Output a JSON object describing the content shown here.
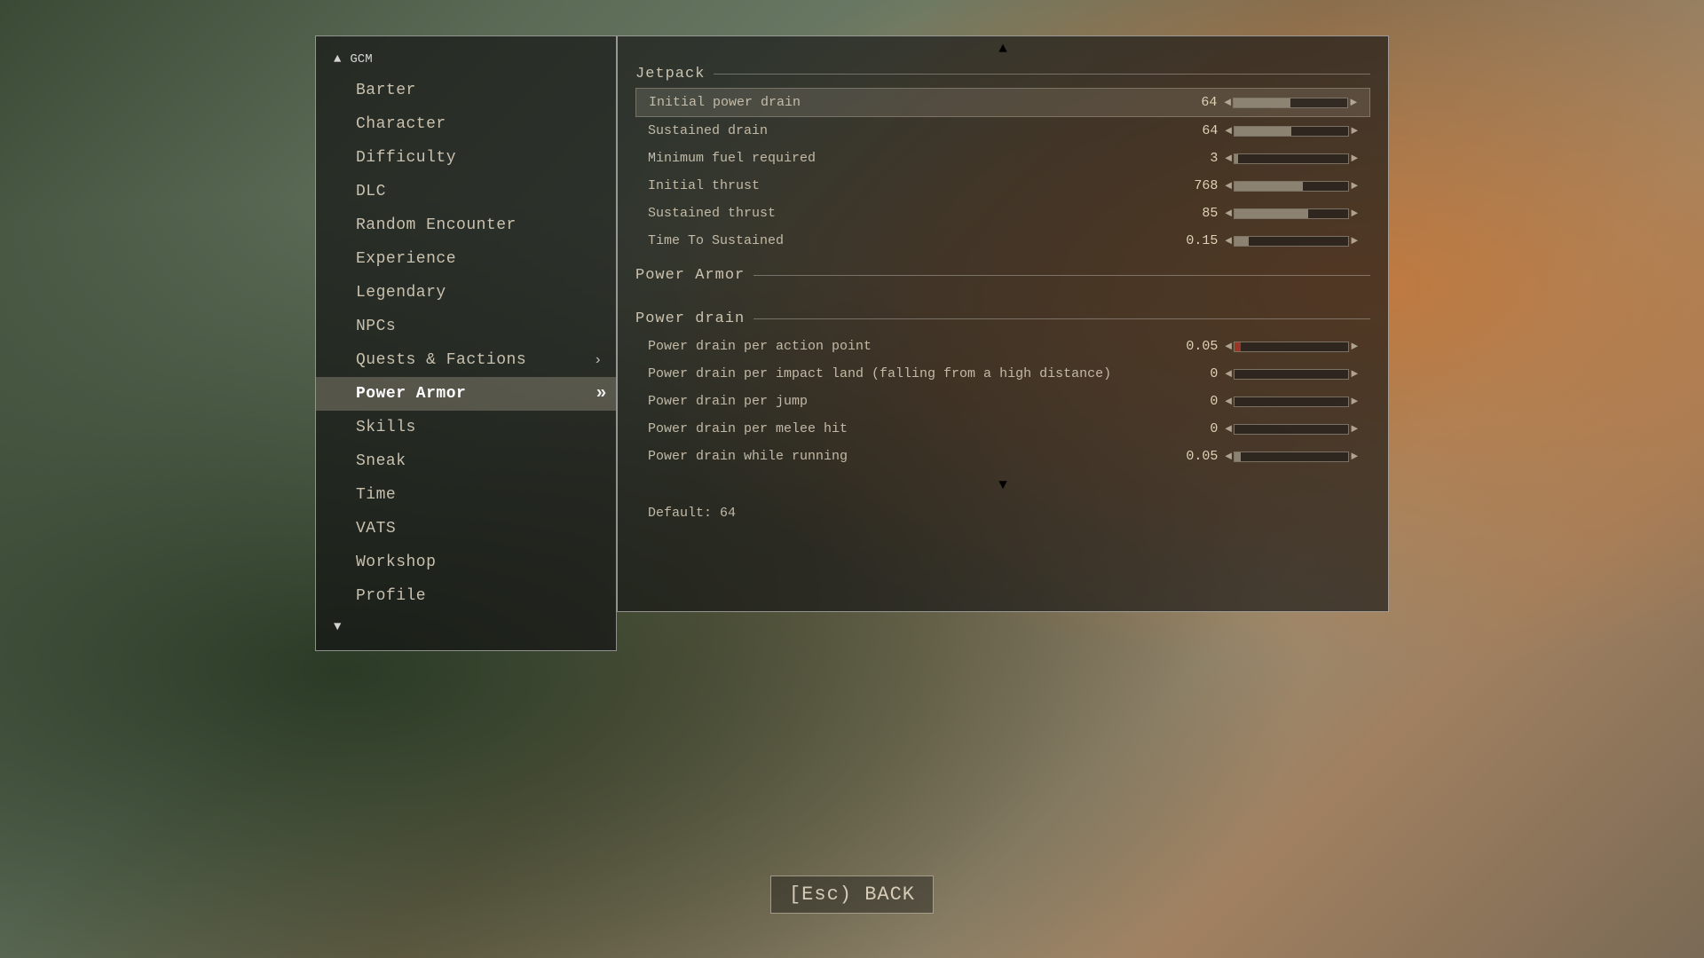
{
  "leftPanel": {
    "gcm_label": "GCM",
    "up_arrow": "▲",
    "down_arrow": "▼",
    "items": [
      {
        "label": "Barter",
        "active": false,
        "has_arrow": false
      },
      {
        "label": "Character",
        "active": false,
        "has_arrow": false
      },
      {
        "label": "Difficulty",
        "active": false,
        "has_arrow": false
      },
      {
        "label": "DLC",
        "active": false,
        "has_arrow": false
      },
      {
        "label": "Random Encounter",
        "active": false,
        "has_arrow": false
      },
      {
        "label": "Experience",
        "active": false,
        "has_arrow": false
      },
      {
        "label": "Legendary",
        "active": false,
        "has_arrow": false
      },
      {
        "label": "NPCs",
        "active": false,
        "has_arrow": false
      },
      {
        "label": "Quests & Factions",
        "active": false,
        "has_arrow": true
      },
      {
        "label": "Power Armor",
        "active": true,
        "has_arrow": true
      },
      {
        "label": "Skills",
        "active": false,
        "has_arrow": false
      },
      {
        "label": "Sneak",
        "active": false,
        "has_arrow": false
      },
      {
        "label": "Time",
        "active": false,
        "has_arrow": false
      },
      {
        "label": "VATS",
        "active": false,
        "has_arrow": false
      },
      {
        "label": "Workshop",
        "active": false,
        "has_arrow": false
      },
      {
        "label": "Profile",
        "active": false,
        "has_arrow": false
      }
    ]
  },
  "rightPanel": {
    "sections": [
      {
        "header": "Jetpack",
        "rows": [
          {
            "label": "Initial power drain",
            "value": "64",
            "fill_pct": 50,
            "highlighted": true,
            "red": false
          },
          {
            "label": "Sustained drain",
            "value": "64",
            "fill_pct": 50,
            "highlighted": false,
            "red": false
          },
          {
            "label": "Minimum fuel required",
            "value": "3",
            "fill_pct": 3,
            "highlighted": false,
            "red": false
          },
          {
            "label": "Initial thrust",
            "value": "768",
            "fill_pct": 60,
            "highlighted": false,
            "red": false
          },
          {
            "label": "Sustained thrust",
            "value": "85",
            "fill_pct": 65,
            "highlighted": false,
            "red": false
          },
          {
            "label": "Time To Sustained",
            "value": "0.15",
            "fill_pct": 12,
            "highlighted": false,
            "red": false
          }
        ]
      },
      {
        "header": "Power Armor",
        "rows": []
      },
      {
        "header": "Power drain",
        "rows": [
          {
            "label": "Power drain per action point",
            "value": "0.05",
            "fill_pct": 5,
            "highlighted": false,
            "red": true
          },
          {
            "label": "Power drain per impact land (falling from a high distance)",
            "value": "0",
            "fill_pct": 0,
            "highlighted": false,
            "red": false
          },
          {
            "label": "Power drain per jump",
            "value": "0",
            "fill_pct": 0,
            "highlighted": false,
            "red": false
          },
          {
            "label": "Power drain per melee hit",
            "value": "0",
            "fill_pct": 0,
            "highlighted": false,
            "red": false
          },
          {
            "label": "Power drain while running",
            "value": "0.05",
            "fill_pct": 5,
            "highlighted": false,
            "red": false
          }
        ]
      }
    ],
    "default_text": "Default: 64",
    "scroll_up": "▲",
    "scroll_down": "▼"
  },
  "footer": {
    "esc_label": "[Esc) BACK"
  }
}
